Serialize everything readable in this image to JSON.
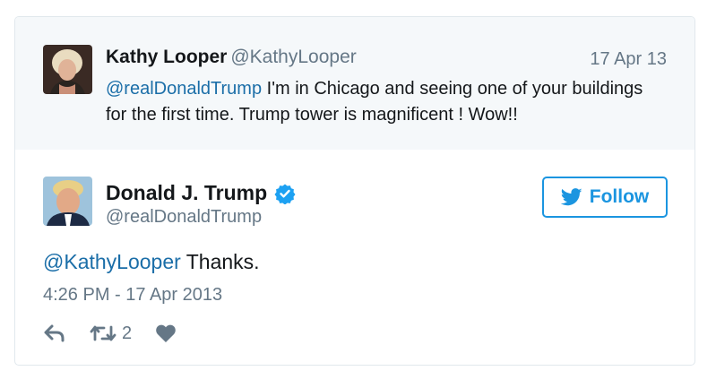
{
  "parent_tweet": {
    "author_name": "Kathy Looper",
    "author_handle": "@KathyLooper",
    "date": "17 Apr 13",
    "mention": "@realDonaldTrump",
    "text": " I'm in Chicago and seeing one of your buildings for the first time. Trump tower is magnificent ! Wow!!"
  },
  "main_tweet": {
    "author_name": "Donald J. Trump",
    "author_handle": "@realDonaldTrump",
    "verified_icon": "verified-badge-icon",
    "mention": "@KathyLooper",
    "text": " Thanks.",
    "timestamp": "4:26 PM - 17 Apr 2013"
  },
  "follow_button": {
    "label": "Follow",
    "icon": "twitter-bird-icon"
  },
  "actions": {
    "reply_icon": "reply-icon",
    "retweet_icon": "retweet-icon",
    "retweet_count": "2",
    "like_icon": "heart-icon"
  },
  "colors": {
    "link": "#1b6ea8",
    "brand": "#1b95e0",
    "muted": "#657786",
    "parent_bg": "#f5f8fa",
    "text": "#14171a"
  }
}
